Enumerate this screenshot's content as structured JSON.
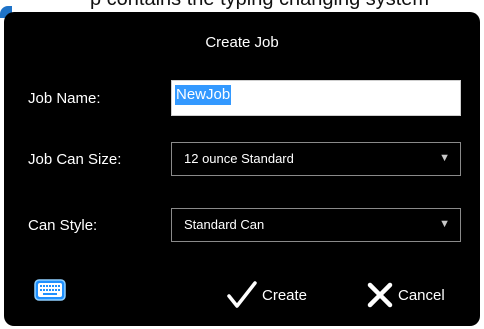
{
  "top_clipped_text": "p contains the typing changing system",
  "dialog": {
    "title": "Create Job",
    "job_name": {
      "label": "Job Name:",
      "value": "NewJob"
    },
    "job_can_size": {
      "label": "Job Can Size:",
      "value": "12 ounce Standard"
    },
    "can_style": {
      "label": "Can Style:",
      "value": "Standard Can"
    },
    "buttons": {
      "create": "Create",
      "cancel": "Cancel"
    },
    "icons": {
      "keyboard": "keyboard-icon",
      "create": "checkmark-icon",
      "cancel": "x-icon",
      "dropdown": "triangle-down-icon"
    },
    "colors": {
      "background": "#000000",
      "selection": "#3399ff",
      "keyboard_icon": "#1e90ff"
    }
  }
}
